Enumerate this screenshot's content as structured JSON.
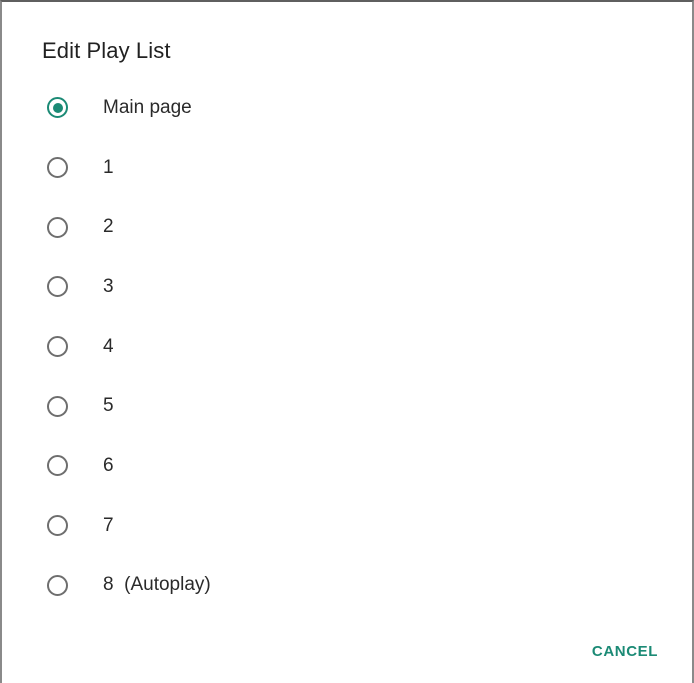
{
  "dialog": {
    "title": "Edit Play List",
    "selected_index": 0,
    "options": [
      {
        "label": "Main page",
        "checked": true
      },
      {
        "label": "1",
        "checked": false
      },
      {
        "label": "2",
        "checked": false
      },
      {
        "label": "3",
        "checked": false
      },
      {
        "label": "4",
        "checked": false
      },
      {
        "label": "5",
        "checked": false
      },
      {
        "label": "6",
        "checked": false
      },
      {
        "label": "7",
        "checked": false
      },
      {
        "label": "8  (Autoplay)",
        "checked": false
      }
    ],
    "cancel_label": "CANCEL",
    "accent_color": "#1b8a75"
  }
}
